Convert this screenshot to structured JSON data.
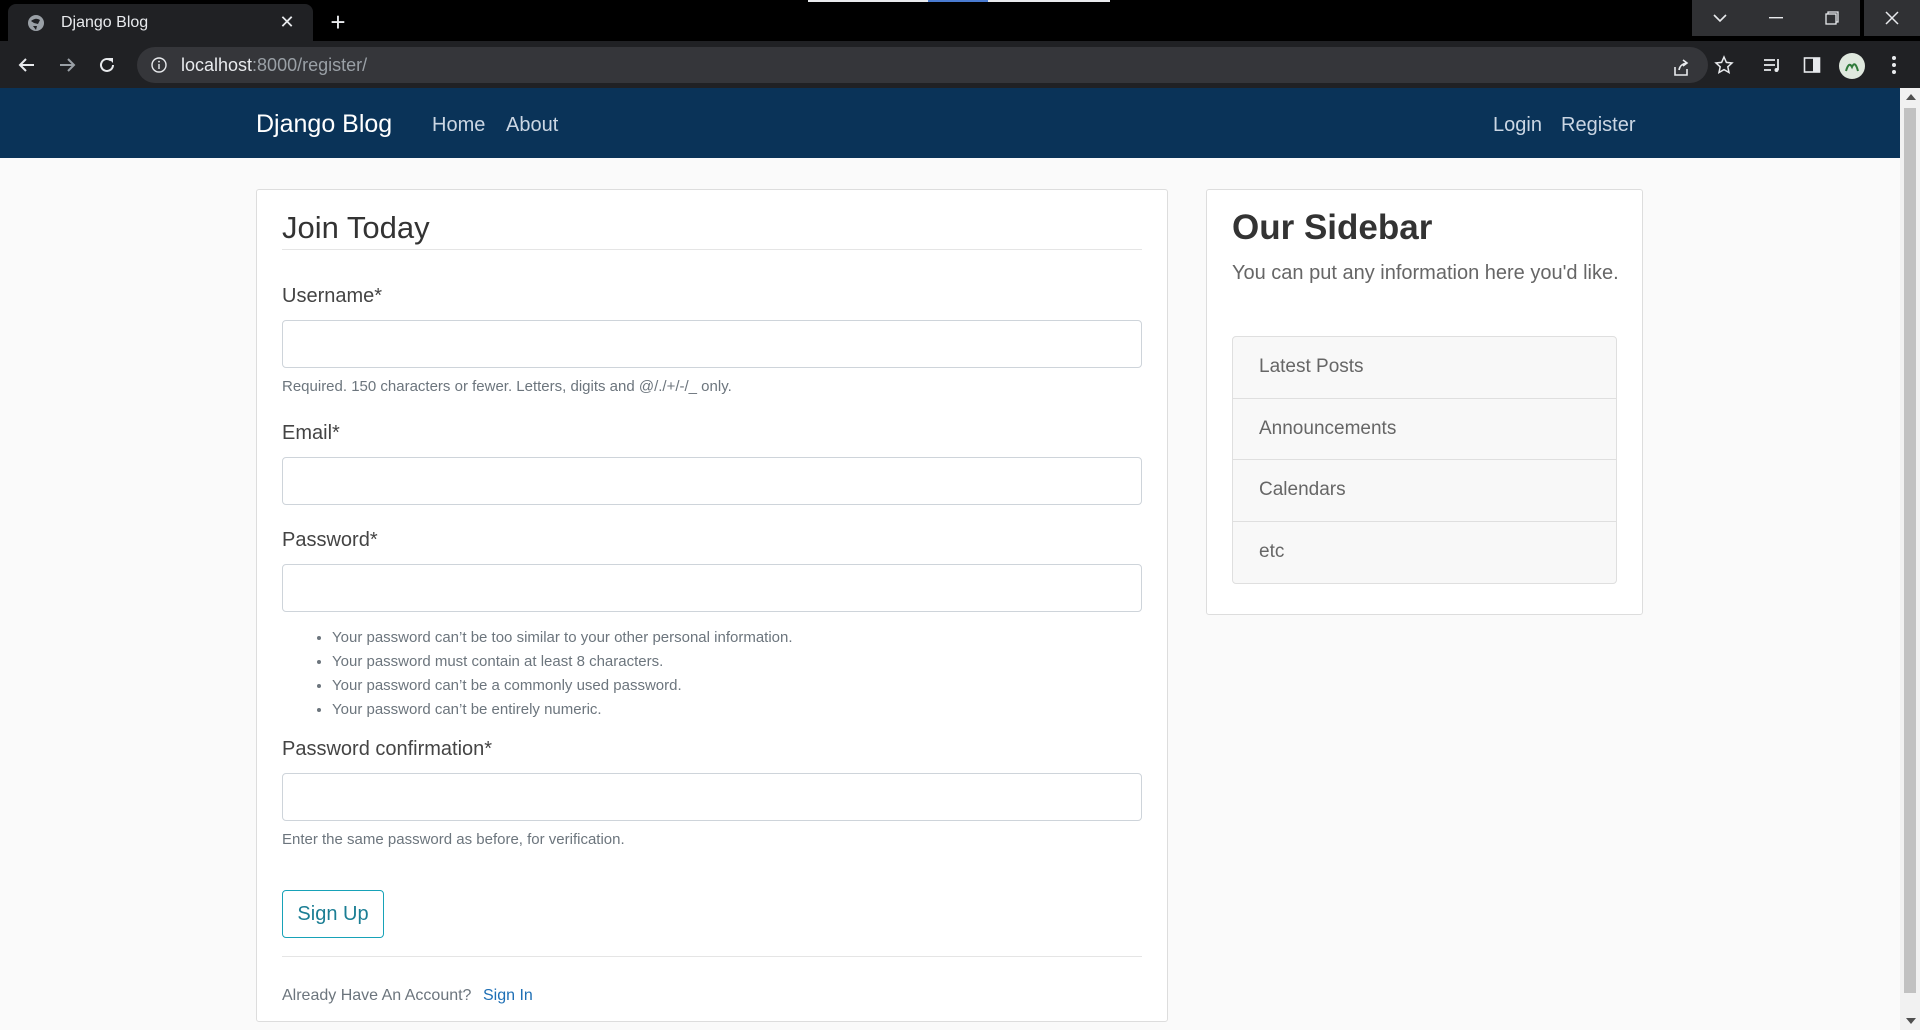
{
  "browser": {
    "tab_title": "Django Blog",
    "url_host": "localhost",
    "url_path": ":8000/register/"
  },
  "navbar": {
    "brand": "Django Blog",
    "links": [
      "Home",
      "About"
    ],
    "right_links": [
      "Login",
      "Register"
    ]
  },
  "form": {
    "legend": "Join Today",
    "username": {
      "label": "Username*",
      "help": "Required. 150 characters or fewer. Letters, digits and @/./+/-/_ only."
    },
    "email": {
      "label": "Email*"
    },
    "password": {
      "label": "Password*",
      "rules": [
        "Your password can’t be too similar to your other personal information.",
        "Your password must contain at least 8 characters.",
        "Your password can’t be a commonly used password.",
        "Your password can’t be entirely numeric."
      ]
    },
    "password_confirm": {
      "label": "Password confirmation*",
      "help": "Enter the same password as before, for verification."
    },
    "submit_label": "Sign Up",
    "footer_text": "Already Have An Account?",
    "footer_link": "Sign In"
  },
  "sidebar": {
    "title": "Our Sidebar",
    "text": "You can put any information here you'd like.",
    "items": [
      "Latest Posts",
      "Announcements",
      "Calendars",
      "etc"
    ]
  },
  "colors": {
    "navbar_bg": "#0a3358",
    "button_border": "#17a2b8",
    "link": "#1e6fb5"
  }
}
